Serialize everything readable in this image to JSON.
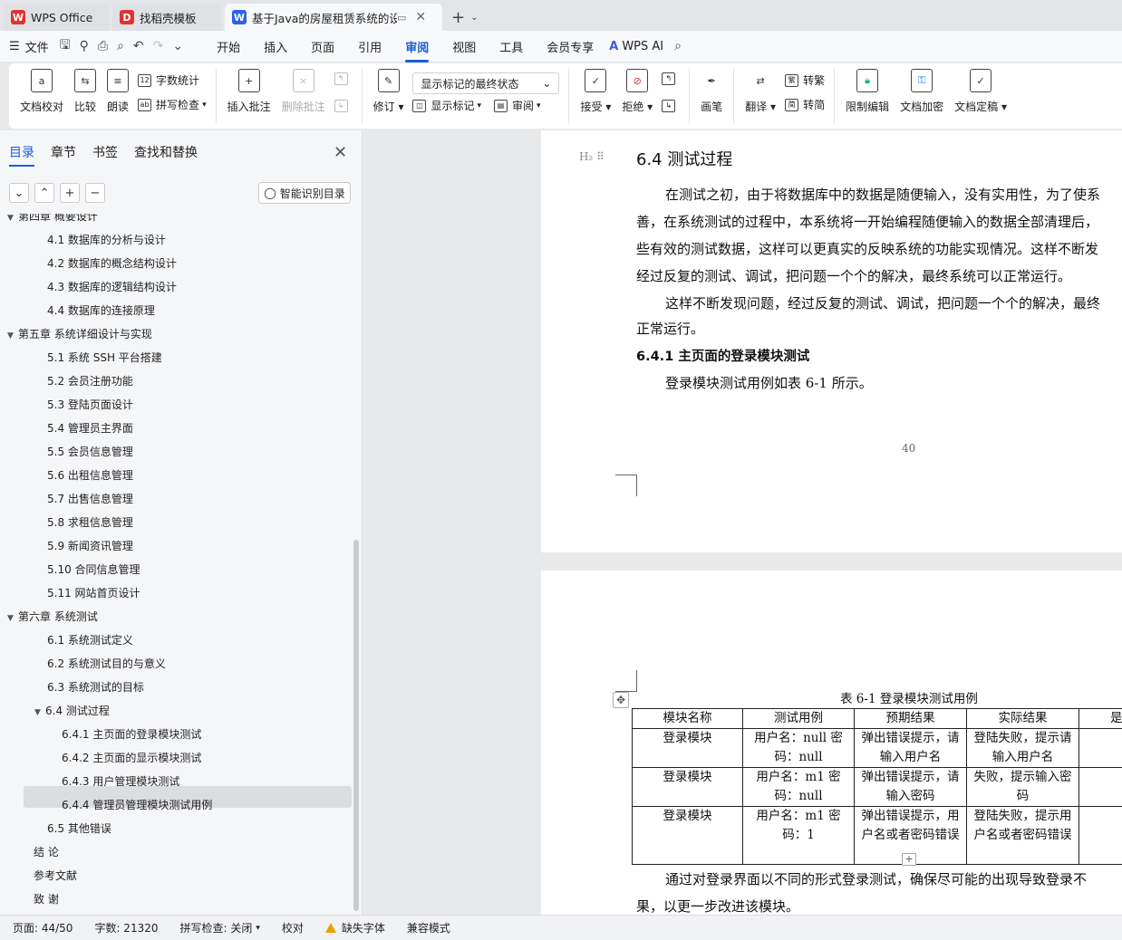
{
  "tabs": [
    {
      "label": "WPS Office",
      "icon": "wps-logo-icon",
      "color": "#e0332f"
    },
    {
      "label": "找稻壳模板",
      "icon": "docer-icon",
      "color": "#e0332f"
    },
    {
      "label": "基于Java的房屋租赁系统的设",
      "icon": "word-doc-icon",
      "color": "#2a62e8"
    }
  ],
  "menubar": {
    "file": "文件",
    "tabs": [
      "开始",
      "插入",
      "页面",
      "引用",
      "审阅",
      "视图",
      "工具",
      "会员专享"
    ],
    "active_tab": "审阅",
    "wps_ai": "WPS AI"
  },
  "ribbon": {
    "doc_proof": "文档校对",
    "compare": "比较",
    "read_aloud": "朗读",
    "word_count": "字数统计",
    "spell_check": "拼写检查",
    "insert_comment": "插入批注",
    "delete_comment": "删除批注",
    "track": "修订",
    "markup_state": "显示标记的最终状态",
    "show_markup": "显示标记",
    "review_pane": "审阅",
    "accept": "接受",
    "reject": "拒绝",
    "pen": "画笔",
    "translate": "翻译",
    "to_traditional": "转繁",
    "to_simplified": "转简",
    "restrict_edit": "限制编辑",
    "encrypt": "文档加密",
    "finalize": "文档定稿"
  },
  "nav": {
    "tabs": [
      "目录",
      "章节",
      "书签",
      "查找和替换"
    ],
    "smart_toc": "智能识别目录",
    "toc": [
      {
        "text": "第四章  概要设计",
        "level": 1
      },
      {
        "text": "4.1 数据库的分析与设计",
        "level": 2
      },
      {
        "text": "4.2 数据库的概念结构设计",
        "level": 2
      },
      {
        "text": "4.3 数据库的逻辑结构设计",
        "level": 2
      },
      {
        "text": "4.4 数据库的连接原理",
        "level": 2
      },
      {
        "text": "第五章  系统详细设计与实现",
        "level": 1
      },
      {
        "text": "5.1 系统 SSH 平台搭建",
        "level": 2
      },
      {
        "text": "5.2 会员注册功能",
        "level": 2
      },
      {
        "text": "5.3 登陆页面设计",
        "level": 2
      },
      {
        "text": "5.4 管理员主界面",
        "level": 2
      },
      {
        "text": "5.5 会员信息管理",
        "level": 2
      },
      {
        "text": "5.6 出租信息管理",
        "level": 2
      },
      {
        "text": "5.7 出售信息管理",
        "level": 2
      },
      {
        "text": "5.8 求租信息管理",
        "level": 2
      },
      {
        "text": "5.9 新闻资讯管理",
        "level": 2
      },
      {
        "text": "5.10 合同信息管理",
        "level": 2
      },
      {
        "text": "5.11 网站首页设计",
        "level": 2
      },
      {
        "text": "第六章  系统测试",
        "level": 1
      },
      {
        "text": "6.1 系统测试定义",
        "level": 2
      },
      {
        "text": "6.2 系统测试目的与意义",
        "level": 2
      },
      {
        "text": "6.3 系统测试的目标",
        "level": 2
      },
      {
        "text": "6.4 测试过程",
        "level": 2
      },
      {
        "text": "6.4.1 主页面的登录模块测试",
        "level": 3
      },
      {
        "text": "6.4.2 主页面的显示模块测试",
        "level": 3
      },
      {
        "text": "6.4.3 用户管理模块测试",
        "level": 3
      },
      {
        "text": "6.4.4 管理员管理模块测试用例",
        "level": 3
      },
      {
        "text": "6.5 其他错误",
        "level": 2
      },
      {
        "text": "结    论",
        "level": 1
      },
      {
        "text": "参考文献",
        "level": 1
      },
      {
        "text": "致    谢",
        "level": 1
      }
    ]
  },
  "doc": {
    "heading_tag": "H₂",
    "heading": "6.4 测试过程",
    "lines": [
      "在测试之初，由于将数据库中的数据是随便输入，没有实用性，为了使系",
      "善，在系统测试的过程中，本系统将一开始编程随便输入的数据全部清理后，",
      "些有效的测试数据，这样可以更真实的反映系统的功能实现情况。这样不断发",
      "经过反复的测试、调试，把问题一个个的解决，最终系统可以正常运行。",
      "这样不断发现问题，经过反复的测试、调试，把问题一个个的解决，最终",
      "正常运行。"
    ],
    "subheading": "6.4.1 主页面的登录模块测试",
    "intro": "登录模块测试用例如表 6-1 所示。",
    "page_number": "40",
    "table_caption": "表 6-1 登录模块测试用例",
    "table_headers": [
      "模块名称",
      "测试用例",
      "预期结果",
      "实际结果",
      "是"
    ],
    "table_rows": [
      [
        "登录模块",
        "用户名：null    密码：null",
        "弹出错误提示，请输入用户名",
        "登陆失败，提示请输入用户名",
        ""
      ],
      [
        "登录模块",
        "用户名：m1    密码：null",
        "弹出错误提示，请输入密码",
        "失败，提示输入密码",
        ""
      ],
      [
        "登录模块",
        "用户名：m1    密码：1",
        "弹出错误提示，用户名或者密码错误",
        "登陆失败，提示用户名或者密码错误",
        ""
      ]
    ],
    "after1": "通过对登录界面以不同的形式登录测试，确保尽可能的出现导致登录不",
    "after2": "果，以更一步改进该模块。"
  },
  "status": {
    "page": "页面: 44/50",
    "words": "字数: 21320",
    "spell": "拼写检查: 关闭",
    "proof": "校对",
    "missing_font": "缺失字体",
    "compat": "兼容模式"
  }
}
